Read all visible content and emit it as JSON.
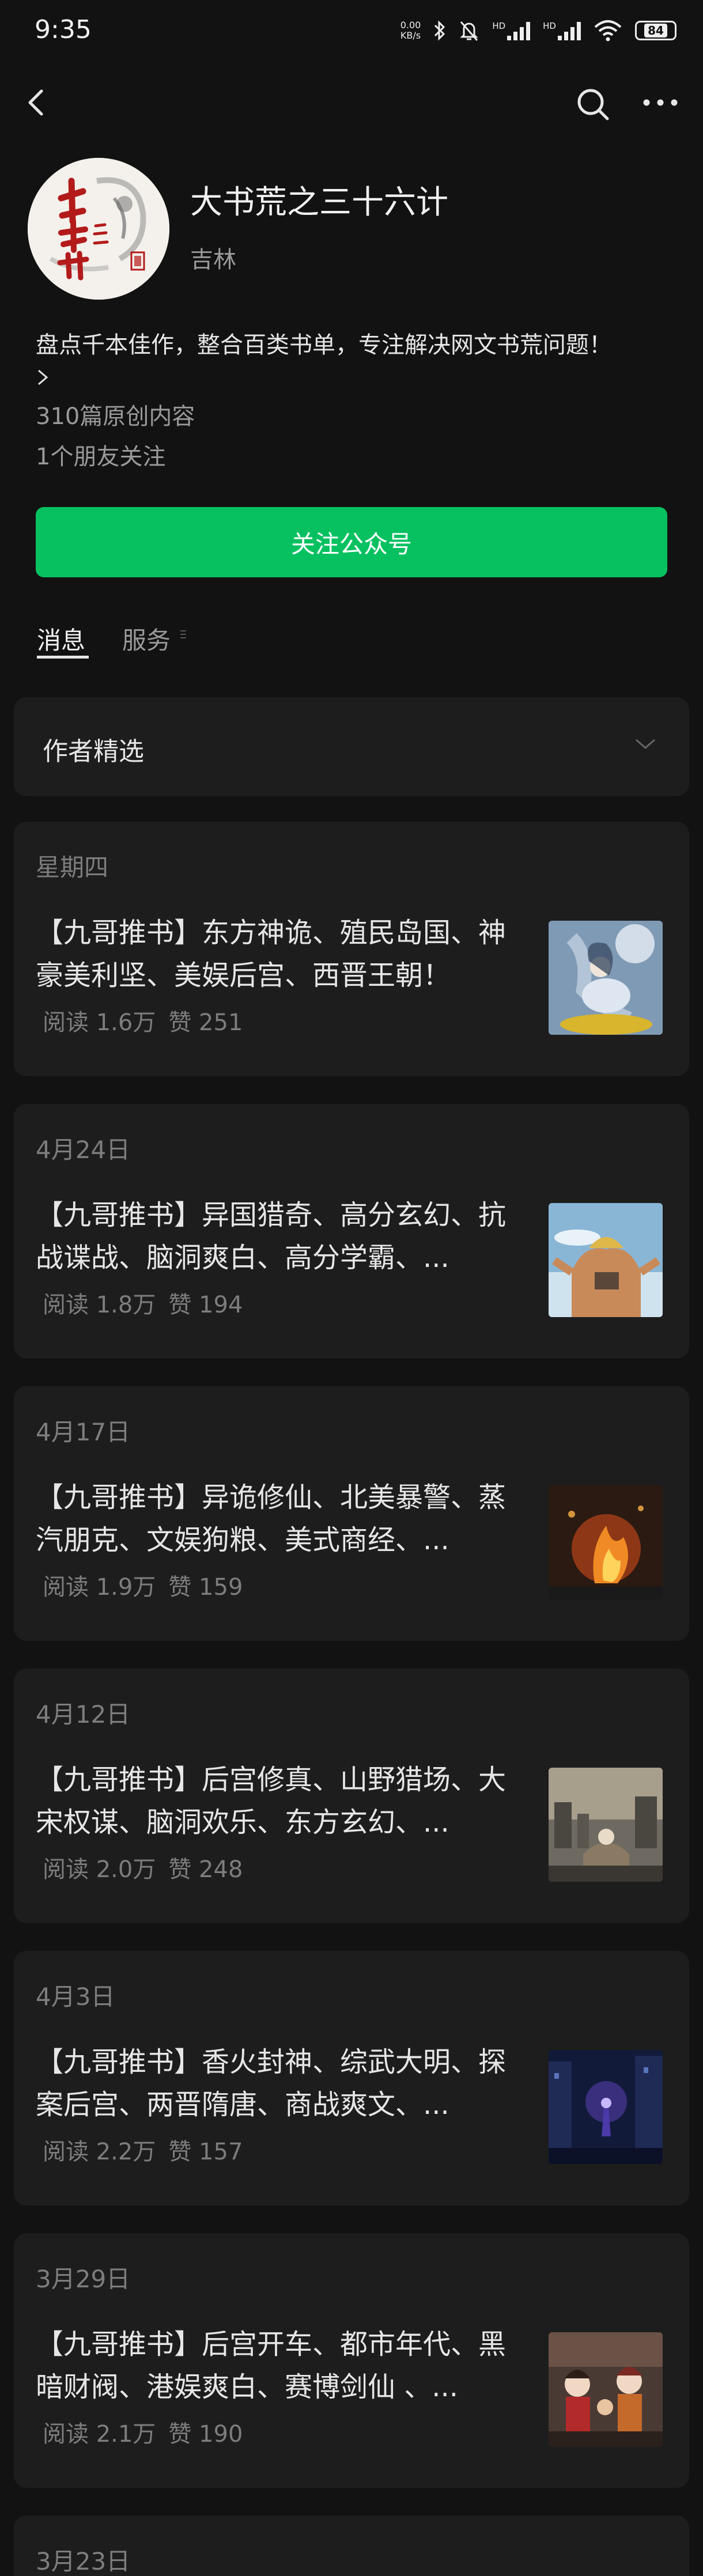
{
  "status_bar": {
    "time": "9:35",
    "net_speed_value": "0.00",
    "net_speed_unit": "KB/s",
    "signal_1_label": "HD",
    "signal_2_label": "HD",
    "battery": "84"
  },
  "account": {
    "name": "大书荒之三十六计",
    "author": "吉林",
    "description": "盘点千本佳作，整合百类书单，专注解决网文书荒问题！",
    "article_count": "310篇原创内容",
    "friends_follow": "1个朋友关注",
    "follow_label": "关注公众号"
  },
  "tabs": [
    {
      "label": "消息",
      "active": true
    },
    {
      "label": "服务",
      "active": false
    }
  ],
  "author_picks": {
    "label": "作者精选"
  },
  "articles": [
    {
      "date": "星期四",
      "title": "【九哥推书】东方神诡、殖民岛国、神豪美利坚、美娱后宫、西晋王朝！",
      "reads": "阅读 1.6万",
      "likes": "赞 251",
      "thumb_icon": "anime-girl-moon-image"
    },
    {
      "date": "4月24日",
      "title": "【九哥推书】异国猎奇、高分玄幻、抗战谍战、脑洞爽白、高分学霸、...",
      "reads": "阅读 1.8万",
      "likes": "赞 194",
      "thumb_icon": "pirate-back-sky-image"
    },
    {
      "date": "4月17日",
      "title": "【九哥推书】异诡修仙、北美暴警、蒸汽朋克、文娱狗粮、美式商经、...",
      "reads": "阅读 1.9万",
      "likes": "赞 159",
      "thumb_icon": "fire-scene-image"
    },
    {
      "date": "4月12日",
      "title": "【九哥推书】后宫修真、山野猎场、大宋权谋、脑洞欢乐、东方玄幻、...",
      "reads": "阅读 2.0万",
      "likes": "赞 248",
      "thumb_icon": "city-ruins-image"
    },
    {
      "date": "4月3日",
      "title": "【九哥推书】香火封神、综武大明、探案后宫、两晋隋唐、商战爽文、...",
      "reads": "阅读 2.2万",
      "likes": "赞 157",
      "thumb_icon": "night-street-image"
    },
    {
      "date": "3月29日",
      "title": "【九哥推书】后宫开车、都市年代、黑暗财阀、港娱爽白、赛博剑仙 、...",
      "reads": "阅读 2.1万",
      "likes": "赞 190",
      "thumb_icon": "anime-group-image"
    },
    {
      "date": "3月23日"
    }
  ],
  "colors": {
    "background": "#121212",
    "card": "#1d1d1d",
    "accent_green": "#07c160",
    "text_primary": "#e6e6e6",
    "text_secondary": "#9a9a9a",
    "text_muted": "#7d7d7d"
  }
}
